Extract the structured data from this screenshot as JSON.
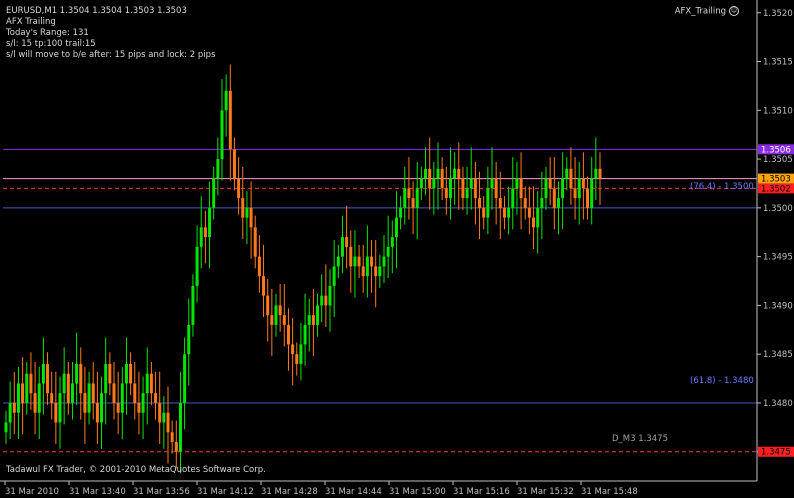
{
  "header": {
    "symbol_line": "EURUSD,M1  1.3504 1.3504 1.3503 1.3503",
    "lines": [
      "AFX Trailing",
      "Today's Range: 131",
      "s/l: 15  tp:100  trail:15",
      "s/l will move to b/e after: 15 pips   and lock: 2 pips"
    ]
  },
  "ea": {
    "name": "AFX_Trailing",
    "icon": "smiley-icon"
  },
  "footer": {
    "copyright": "Tadawul FX Trader, © 2001-2010 MetaQuotes Software Corp."
  },
  "colors": {
    "background": "#000000",
    "axis": "#c0c0c0",
    "bull": "#00e600",
    "bear": "#ff7a1a",
    "purple_line": "#8a2be2",
    "fib_line": "#4a5ac8",
    "red_dashed": "#ff3030",
    "pink_line": "#ff9bd0",
    "bid_label": "#ffa500",
    "ask_label": "#ff2020",
    "top_label": "#8a2be2"
  },
  "chart_data": {
    "type": "candlestick",
    "symbol": "EURUSD",
    "timeframe": "M1",
    "ylim": [
      1.3472,
      1.3521
    ],
    "price_ticks": [
      "1.3520",
      "1.3515",
      "1.3510",
      "1.3505",
      "1.3500",
      "1.3495",
      "1.3490",
      "1.3485",
      "1.3480",
      "1.3475"
    ],
    "price_tick_values": [
      1.352,
      1.3515,
      1.351,
      1.3505,
      1.35,
      1.3495,
      1.349,
      1.3485,
      1.348,
      1.3475
    ],
    "time_labels": [
      "31 Mar 2010",
      "31 Mar 13:40",
      "31 Mar 13:56",
      "31 Mar 14:12",
      "31 Mar 14:28",
      "31 Mar 14:44",
      "31 Mar 15:00",
      "31 Mar 15:16",
      "31 Mar 15:32",
      "31 Mar 15:48"
    ],
    "levels": [
      {
        "name": "upper purple line",
        "price": 1.3506,
        "label": "1.3506",
        "style": "solid",
        "color": "purple_line"
      },
      {
        "name": "bid",
        "price": 1.3503,
        "label": "1.3503",
        "style": "solid",
        "color": "pink_line"
      },
      {
        "name": "stop",
        "price": 1.3502,
        "label": "1.3502",
        "style": "dashed",
        "color": "red_dashed"
      },
      {
        "name": "fib 76.4",
        "price": 1.35,
        "label": "(76.4) - 1.3500",
        "style": "solid",
        "color": "fib_line"
      },
      {
        "name": "fib 61.8",
        "price": 1.348,
        "label": "(61.8) - 1.3480",
        "style": "solid",
        "color": "fib_line"
      },
      {
        "name": "D_M3",
        "price": 1.3475,
        "label": "1.3475",
        "text": "D_M3 1.3475",
        "style": "dashed",
        "color": "red_dashed"
      }
    ],
    "close_series": [
      1.3478,
      1.348,
      1.3479,
      1.3482,
      1.348,
      1.3483,
      1.3481,
      1.3479,
      1.3482,
      1.3484,
      1.3481,
      1.348,
      1.3478,
      1.3481,
      1.3483,
      1.348,
      1.3482,
      1.3484,
      1.3481,
      1.3479,
      1.3482,
      1.348,
      1.3478,
      1.3481,
      1.3484,
      1.3482,
      1.348,
      1.3479,
      1.3482,
      1.3484,
      1.3482,
      1.348,
      1.3479,
      1.3481,
      1.3483,
      1.3481,
      1.348,
      1.3478,
      1.3479,
      1.3477,
      1.3476,
      1.3475,
      1.348,
      1.3485,
      1.3488,
      1.3492,
      1.3496,
      1.3498,
      1.3497,
      1.35,
      1.3503,
      1.3505,
      1.351,
      1.3512,
      1.3506,
      1.3503,
      1.3501,
      1.3499,
      1.35,
      1.3498,
      1.3495,
      1.3493,
      1.3491,
      1.3489,
      1.3488,
      1.349,
      1.3489,
      1.3488,
      1.3486,
      1.3485,
      1.3484,
      1.3486,
      1.3488,
      1.3489,
      1.3488,
      1.349,
      1.3491,
      1.349,
      1.3492,
      1.3494,
      1.3495,
      1.3497,
      1.3496,
      1.3494,
      1.3495,
      1.3494,
      1.3493,
      1.3495,
      1.3494,
      1.3493,
      1.3494,
      1.3495,
      1.3496,
      1.3497,
      1.3499,
      1.35,
      1.3502,
      1.3501,
      1.35,
      1.3502,
      1.3503,
      1.3504,
      1.3502,
      1.3503,
      1.3504,
      1.3502,
      1.3501,
      1.3503,
      1.3504,
      1.3503,
      1.3501,
      1.3502,
      1.3503,
      1.3501,
      1.35,
      1.3499,
      1.3502,
      1.3503,
      1.3501,
      1.35,
      1.3499,
      1.35,
      1.3502,
      1.3503,
      1.3501,
      1.35,
      1.3499,
      1.3498,
      1.35,
      1.3501,
      1.3503,
      1.3502,
      1.35,
      1.3501,
      1.3503,
      1.3504,
      1.3502,
      1.3501,
      1.3503,
      1.3502,
      1.35,
      1.3503,
      1.3504,
      1.3503
    ]
  }
}
